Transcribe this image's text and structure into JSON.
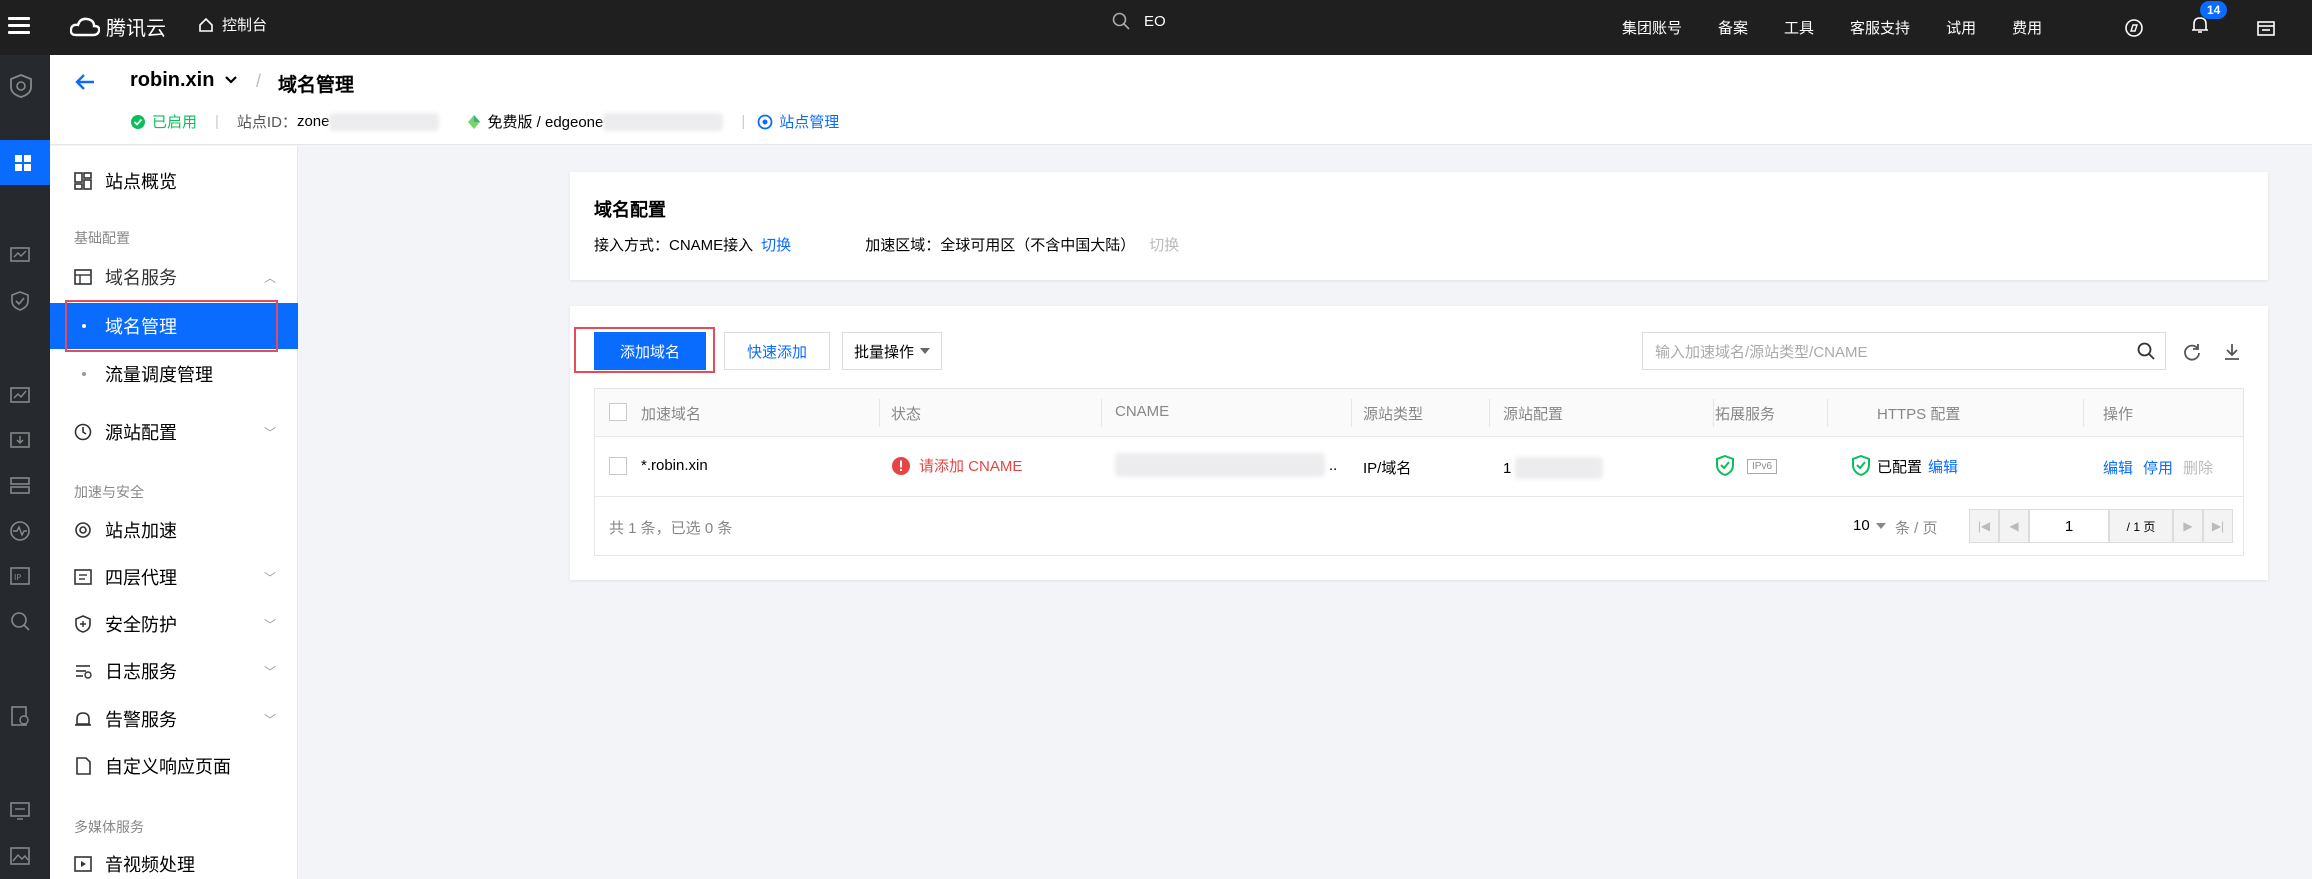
{
  "topbar": {
    "brand": "腾讯云",
    "console": "控制台",
    "search_value": "EO",
    "nav": [
      "集团账号",
      "备案",
      "工具",
      "客服支持",
      "试用",
      "费用"
    ],
    "notification_count": "14"
  },
  "header": {
    "site_name": "robin.xin",
    "page_title": "域名管理",
    "status": "已启用",
    "site_id_label": "站点ID：",
    "site_id_prefix": "zone",
    "plan_prefix": "免费版 / edgeone",
    "site_manage_link": "站点管理"
  },
  "sidebar": {
    "overview": "站点概览",
    "group_basic": "基础配置",
    "domain_service": "域名服务",
    "domain_manage": "域名管理",
    "traffic_schedule": "流量调度管理",
    "origin_config": "源站配置",
    "group_accel": "加速与安全",
    "site_accel": "站点加速",
    "l4_proxy": "四层代理",
    "security": "安全防护",
    "log_service": "日志服务",
    "alarm_service": "告警服务",
    "custom_page": "自定义响应页面",
    "group_media": "多媒体服务",
    "av_processing": "音视频处理"
  },
  "domain_config": {
    "title": "域名配置",
    "access_label": "接入方式：CNAME接入",
    "access_switch": "切换",
    "region_label": "加速区域：全球可用区（不含中国大陆）",
    "region_switch": "切换"
  },
  "toolbar": {
    "add_domain": "添加域名",
    "quick_add": "快速添加",
    "batch_ops": "批量操作",
    "search_placeholder": "输入加速域名/源站类型/CNAME"
  },
  "table": {
    "headers": [
      "加速域名",
      "状态",
      "CNAME",
      "源站类型",
      "源站配置",
      "拓展服务",
      "HTTPS 配置",
      "操作"
    ],
    "row": {
      "domain": "*.robin.xin",
      "status": "请添加 CNAME",
      "cname_suffix": "..",
      "origin_type": "IP/域名",
      "origin_prefix": "1",
      "ipv6": "IPv6",
      "https": "已配置",
      "https_edit": "编辑",
      "op_edit": "编辑",
      "op_stop": "停用",
      "op_delete": "删除"
    },
    "summary": "共 1 条，已选 0 条",
    "page_size": "10",
    "page_size_unit": "条 / 页",
    "current_page": "1",
    "total_pages": "/ 1 页"
  },
  "colors": {
    "primary": "#0a6cff",
    "success": "#0abf5b",
    "danger": "#e54545",
    "highlight": "#e34d59"
  }
}
